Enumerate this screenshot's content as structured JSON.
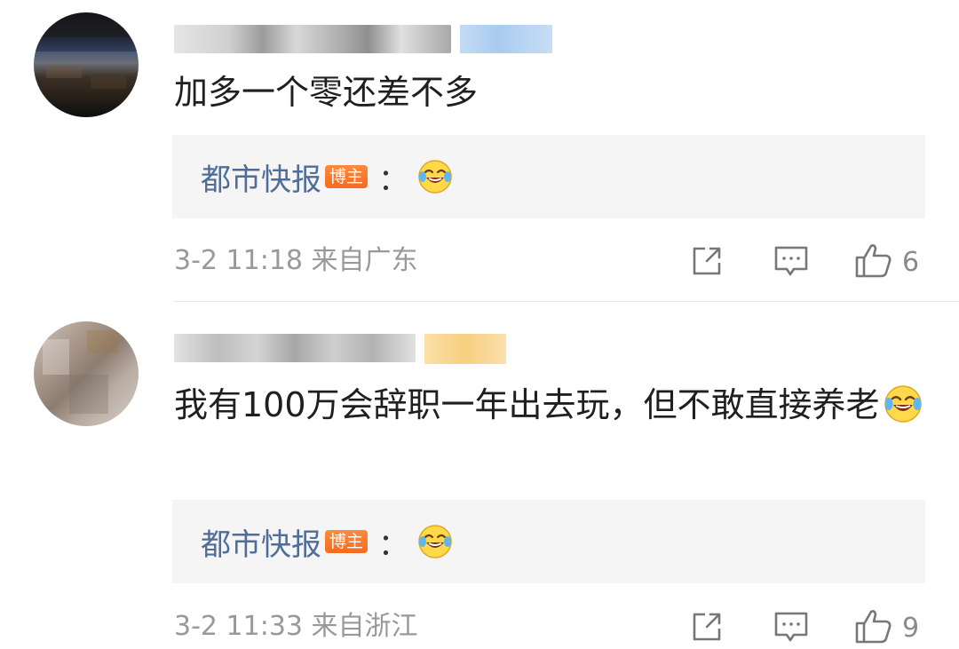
{
  "comments": [
    {
      "text": "加多一个零还差不多",
      "reply": {
        "author": "都市快报",
        "badge": "博主",
        "colon": "：",
        "emoji": "laughing-tears-emoji"
      },
      "meta": "3-2 11:18 来自广东",
      "likes": "6"
    },
    {
      "text": "我有100万会辞职一年出去玩，但不敢直接养老",
      "emoji": "laughing-tears-emoji",
      "reply": {
        "author": "都市快报",
        "badge": "博主",
        "colon": "：",
        "emoji": "laughing-tears-emoji"
      },
      "meta": "3-2 11:33 来自浙江",
      "likes": "9"
    }
  ],
  "colors": {
    "reply_author": "#4f6d97",
    "blogger_badge": "#f56b1f",
    "meta_text": "#999999",
    "reply_background": "#f5f5f5"
  },
  "icons": {
    "share": "share-icon",
    "comment": "comment-icon",
    "like": "thumbs-up-icon"
  }
}
